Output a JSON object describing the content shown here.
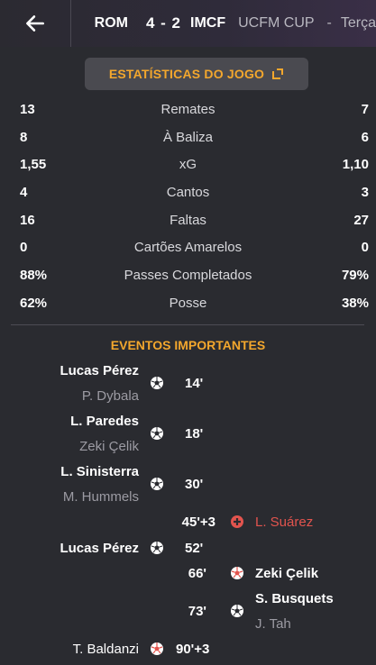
{
  "header": {
    "home": "ROM",
    "score": "4 - 2",
    "away": "IMCF",
    "competition": "UCFM CUP",
    "separator": "-",
    "date": "Terça"
  },
  "stats_button_label": "ESTATÍSTICAS DO JOGO",
  "stats": [
    {
      "label": "Remates",
      "home": "13",
      "away": "7"
    },
    {
      "label": "À Baliza",
      "home": "8",
      "away": "6"
    },
    {
      "label": "xG",
      "home": "1,55",
      "away": "1,10"
    },
    {
      "label": "Cantos",
      "home": "4",
      "away": "3"
    },
    {
      "label": "Faltas",
      "home": "16",
      "away": "27"
    },
    {
      "label": "Cartões Amarelos",
      "home": "0",
      "away": "0"
    },
    {
      "label": "Passes Completados",
      "home": "88%",
      "away": "79%"
    },
    {
      "label": "Posse",
      "home": "62%",
      "away": "38%"
    }
  ],
  "events_title": "EVENTOS IMPORTANTES",
  "events": [
    {
      "side": "home",
      "type": "goal",
      "player": "Lucas Pérez",
      "assist": "P. Dybala",
      "minute": "14'"
    },
    {
      "side": "home",
      "type": "goal",
      "player": "L. Paredes",
      "assist": "Zeki Çelik",
      "minute": "18'"
    },
    {
      "side": "home",
      "type": "goal",
      "player": "L. Sinisterra",
      "assist": "M. Hummels",
      "minute": "30'"
    },
    {
      "side": "away",
      "type": "injury",
      "player": "L. Suárez",
      "minute": "45'+3"
    },
    {
      "side": "home",
      "type": "goal",
      "player": "Lucas Pérez",
      "minute": "52'"
    },
    {
      "side": "away",
      "type": "own-goal",
      "player": "Zeki Çelik",
      "minute": "66'"
    },
    {
      "side": "away",
      "type": "goal",
      "player": "S. Busquets",
      "assist": "J. Tah",
      "minute": "73'"
    },
    {
      "side": "home",
      "type": "own-goal",
      "player": "T. Baldanzi",
      "minute": "90'+3"
    }
  ],
  "colors": {
    "accent": "#f3a72d",
    "red": "#e2544e",
    "background": "#2a2b30"
  }
}
